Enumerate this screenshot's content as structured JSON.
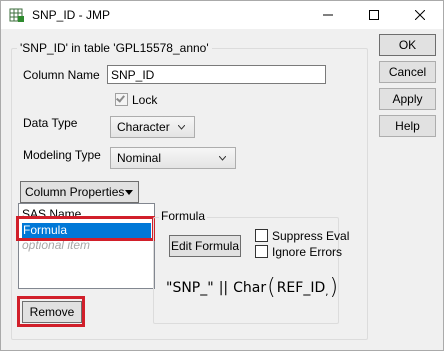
{
  "window": {
    "title": "SNP_ID - JMP",
    "icon": "jmp-app-icon",
    "controls": {
      "minimize": "minimize-icon",
      "maximize": "maximize-icon",
      "close": "close-icon"
    }
  },
  "column_group": {
    "legend": "'SNP_ID' in table 'GPL15578_anno'",
    "column_name_label": "Column Name",
    "column_name_value": "SNP_ID",
    "lock_label": "Lock",
    "lock_checked": true,
    "data_type_label": "Data Type",
    "data_type_value": "Character",
    "modeling_type_label": "Modeling Type",
    "modeling_type_value": "Nominal",
    "column_properties_button": "Column Properties"
  },
  "properties_list": {
    "items": [
      "SAS Name",
      "Formula",
      "optional item"
    ],
    "selected": "Formula"
  },
  "formula_group": {
    "legend": "Formula",
    "edit_button": "Edit Formula",
    "suppress_eval_label": "Suppress Eval",
    "ignore_errors_label": "Ignore Errors",
    "expression": {
      "literal": "\"SNP_\"",
      "operator": "||",
      "function": "Char",
      "argument": "REF_ID"
    }
  },
  "remove_button": "Remove",
  "side_buttons": {
    "ok": "OK",
    "cancel": "Cancel",
    "apply": "Apply",
    "help": "Help"
  },
  "highlight_color": "#d11f2a",
  "selection_color": "#0078d7"
}
